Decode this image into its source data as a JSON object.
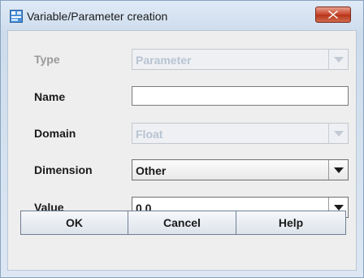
{
  "window": {
    "title": "Variable/Parameter creation",
    "icon": "app-window-icon",
    "close_icon": "close-icon"
  },
  "form": {
    "type": {
      "label": "Type",
      "value": "Parameter",
      "enabled": false
    },
    "name": {
      "label": "Name",
      "value": ""
    },
    "domain": {
      "label": "Domain",
      "value": "Float",
      "enabled": false
    },
    "dimension": {
      "label": "Dimension",
      "value": "Other",
      "enabled": true
    },
    "value": {
      "label": "Value",
      "value": "0.0",
      "enabled": true
    }
  },
  "buttons": {
    "ok": "OK",
    "cancel": "Cancel",
    "help": "Help"
  },
  "colors": {
    "close_button": "#c8452c",
    "disabled_text": "#9a9a9a",
    "disabled_combo_text": "#b8c4d2"
  }
}
